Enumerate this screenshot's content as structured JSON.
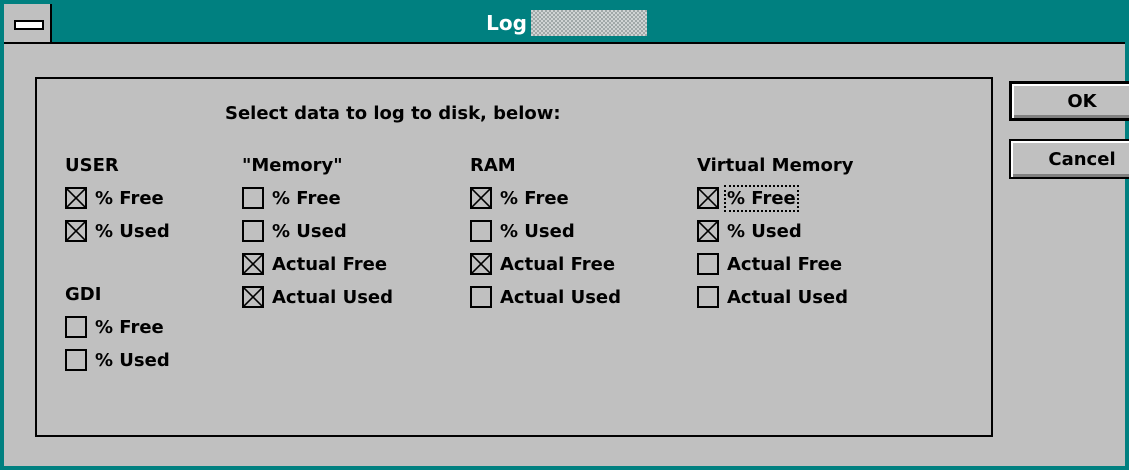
{
  "window": {
    "title": "Log"
  },
  "instructions": "Select data to log to disk, below:",
  "groups": {
    "user": {
      "heading": "USER",
      "items": [
        {
          "label": "% Free",
          "checked": true
        },
        {
          "label": "% Used",
          "checked": true
        }
      ]
    },
    "gdi": {
      "heading": "GDI",
      "items": [
        {
          "label": "% Free",
          "checked": false
        },
        {
          "label": "% Used",
          "checked": false
        }
      ]
    },
    "memory": {
      "heading": "\"Memory\"",
      "items": [
        {
          "label": "% Free",
          "checked": false
        },
        {
          "label": "% Used",
          "checked": false
        },
        {
          "label": "Actual Free",
          "checked": true
        },
        {
          "label": "Actual Used",
          "checked": true
        }
      ]
    },
    "ram": {
      "heading": "RAM",
      "items": [
        {
          "label": "% Free",
          "checked": true
        },
        {
          "label": "% Used",
          "checked": false
        },
        {
          "label": "Actual Free",
          "checked": true
        },
        {
          "label": "Actual Used",
          "checked": false
        }
      ]
    },
    "virtual_memory": {
      "heading": "Virtual Memory",
      "items": [
        {
          "label": "% Free",
          "checked": true,
          "focused": true
        },
        {
          "label": "% Used",
          "checked": true
        },
        {
          "label": "Actual Free",
          "checked": false
        },
        {
          "label": "Actual Used",
          "checked": false
        }
      ]
    }
  },
  "buttons": {
    "ok": "OK",
    "cancel": "Cancel"
  },
  "colors": {
    "titlebar": "#008080",
    "face": "#c0c0c0"
  }
}
